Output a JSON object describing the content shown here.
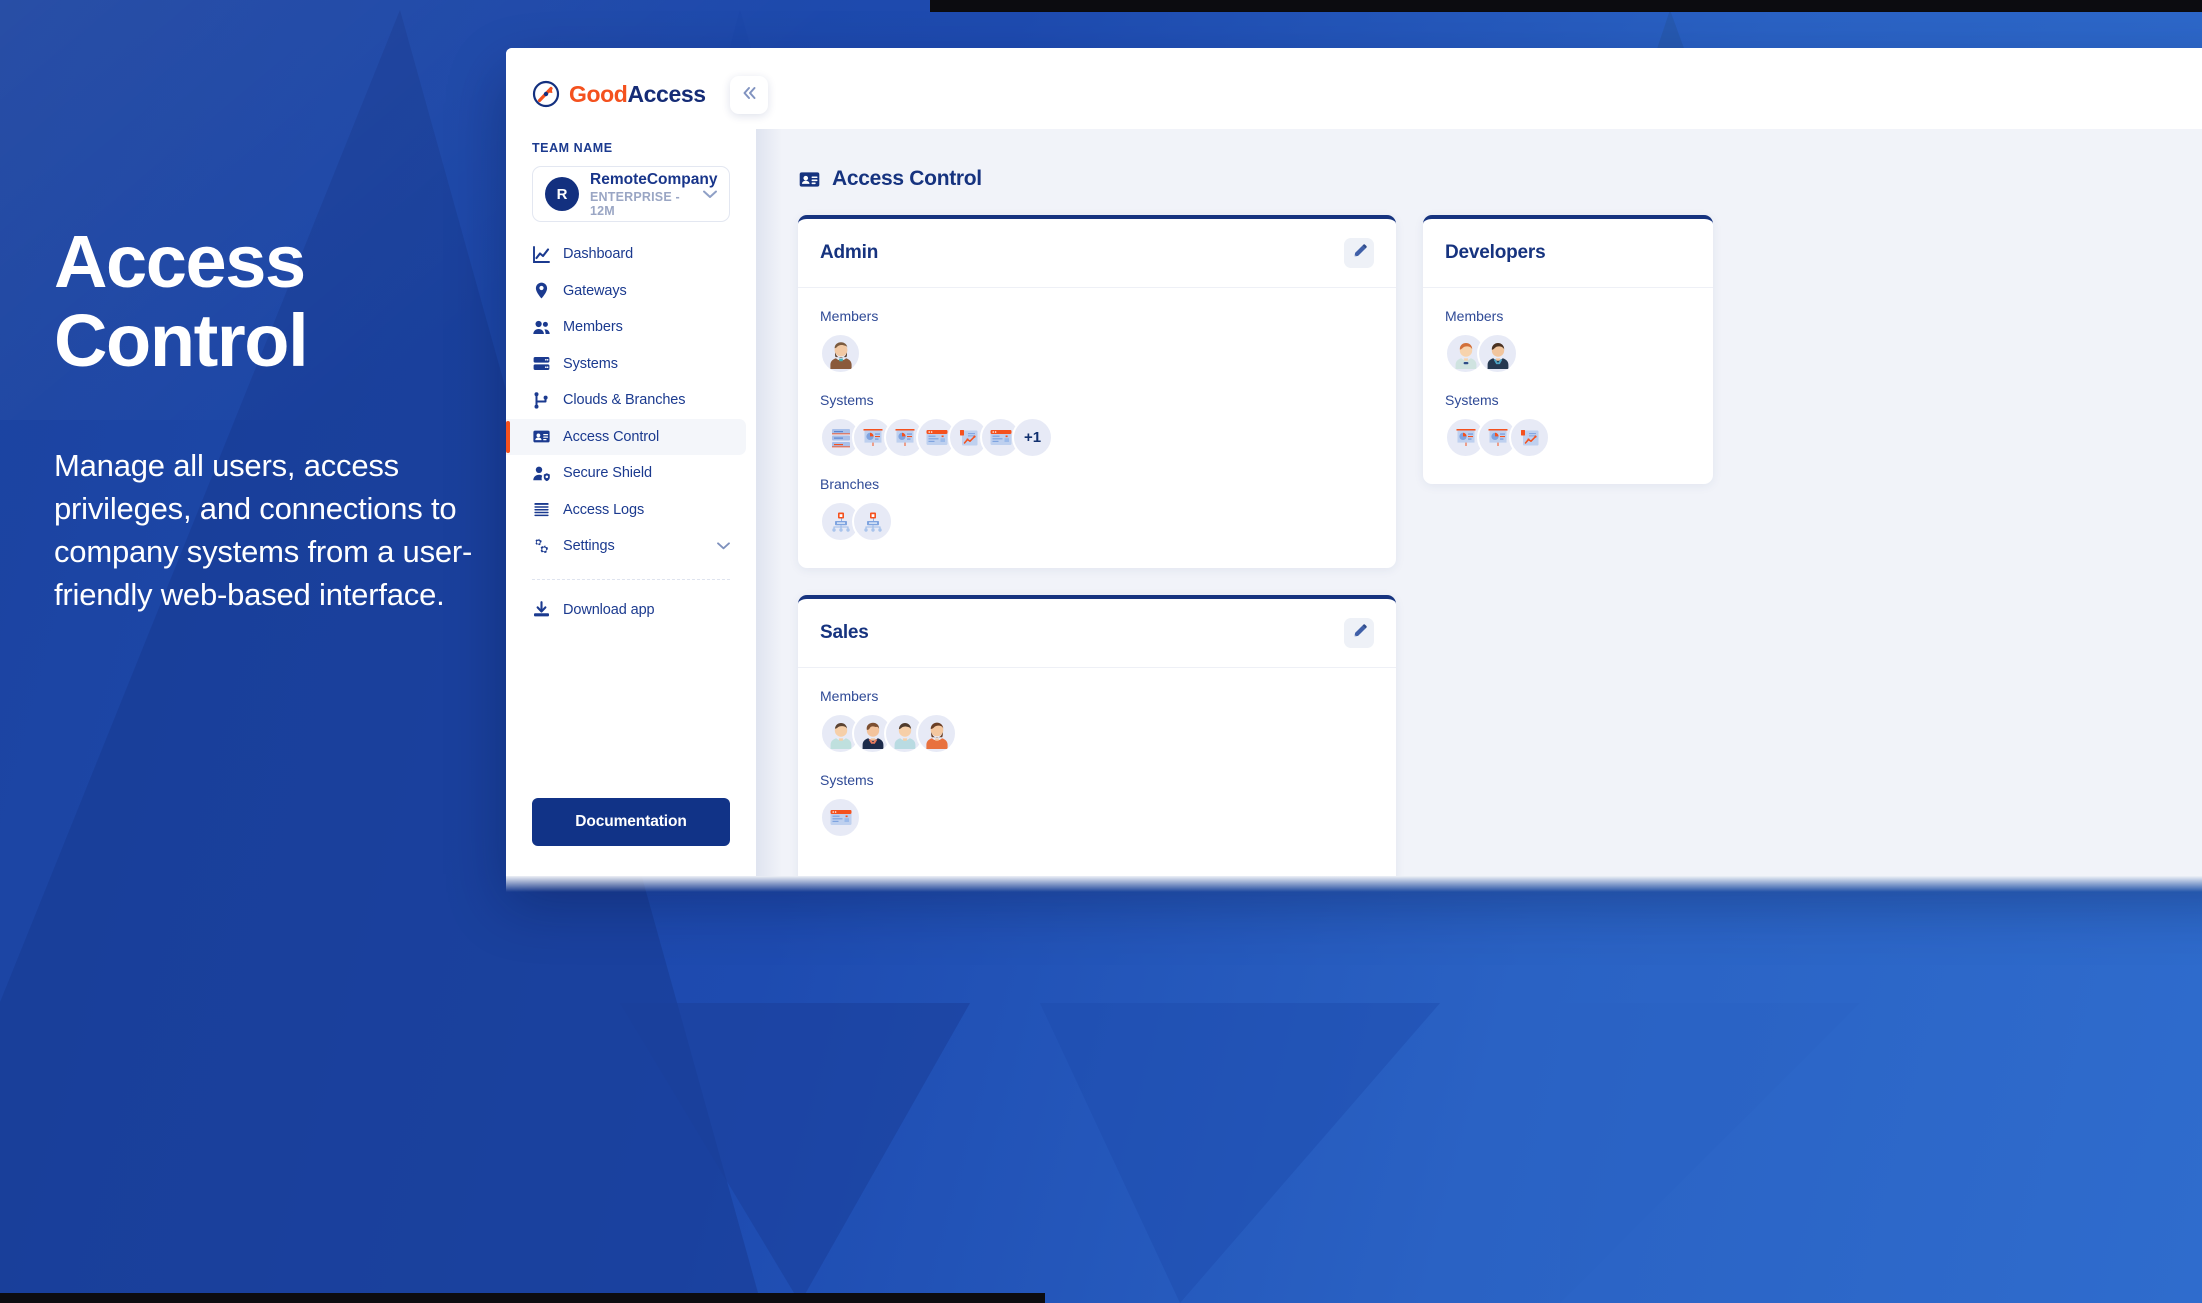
{
  "hero": {
    "title": "Access\nControl",
    "subtitle": "Manage all users, access privileges, and connections to company systems from a user-friendly web-based interface."
  },
  "brand": {
    "name_first": "Good",
    "name_second": "Access",
    "logo_icon": "compass-arrow-icon"
  },
  "sidebar": {
    "team_label": "TEAM NAME",
    "team": {
      "initial": "R",
      "name": "RemoteCompany",
      "plan": "ENTERPRISE - 12M",
      "chevron": "chevron-down-icon"
    },
    "items": [
      {
        "label": "Dashboard",
        "icon": "chart-line-icon",
        "active": false
      },
      {
        "label": "Gateways",
        "icon": "location-pin-icon",
        "active": false
      },
      {
        "label": "Members",
        "icon": "people-icon",
        "active": false
      },
      {
        "label": "Systems",
        "icon": "server-icon",
        "active": false
      },
      {
        "label": "Clouds & Branches",
        "icon": "branch-icon",
        "active": false
      },
      {
        "label": "Access Control",
        "icon": "id-card-icon",
        "active": true
      },
      {
        "label": "Secure Shield",
        "icon": "user-shield-icon",
        "active": false
      },
      {
        "label": "Access Logs",
        "icon": "list-lines-icon",
        "active": false
      },
      {
        "label": "Settings",
        "icon": "gears-icon",
        "active": false,
        "caret": "chevron-down-icon"
      }
    ],
    "download_app": {
      "label": "Download app",
      "icon": "download-icon"
    },
    "documentation_button": "Documentation"
  },
  "topbar": {
    "collapse_icon": "double-chevron-left-icon"
  },
  "main": {
    "page_title": "Access Control",
    "page_icon": "id-card-icon",
    "cards": [
      {
        "title": "Admin",
        "edit_icon": "pencil-icon",
        "sections": [
          {
            "label": "Members",
            "type": "avatars",
            "count": 1,
            "overflow": null
          },
          {
            "label": "Systems",
            "type": "systems",
            "count": 6,
            "overflow": "+1"
          },
          {
            "label": "Branches",
            "type": "branches",
            "count": 2,
            "overflow": null
          }
        ]
      },
      {
        "title": "Sales",
        "edit_icon": "pencil-icon",
        "sections": [
          {
            "label": "Members",
            "type": "avatars",
            "count": 4,
            "overflow": null
          },
          {
            "label": "Systems",
            "type": "systems",
            "count": 1,
            "overflow": null
          }
        ]
      },
      {
        "title": "Developers",
        "edit_icon": null,
        "sections": [
          {
            "label": "Members",
            "type": "avatars",
            "count": 2,
            "overflow": null
          },
          {
            "label": "Systems",
            "type": "systems",
            "count": 3,
            "overflow": null
          }
        ]
      }
    ]
  },
  "colors": {
    "brand_orange": "#f4511e",
    "brand_navy": "#16337f",
    "accent_blue": "#1b43a0",
    "card_top_border": "#16337f",
    "sidebar_active_bg": "#f4f6fa",
    "content_bg": "#f1f3f9"
  }
}
